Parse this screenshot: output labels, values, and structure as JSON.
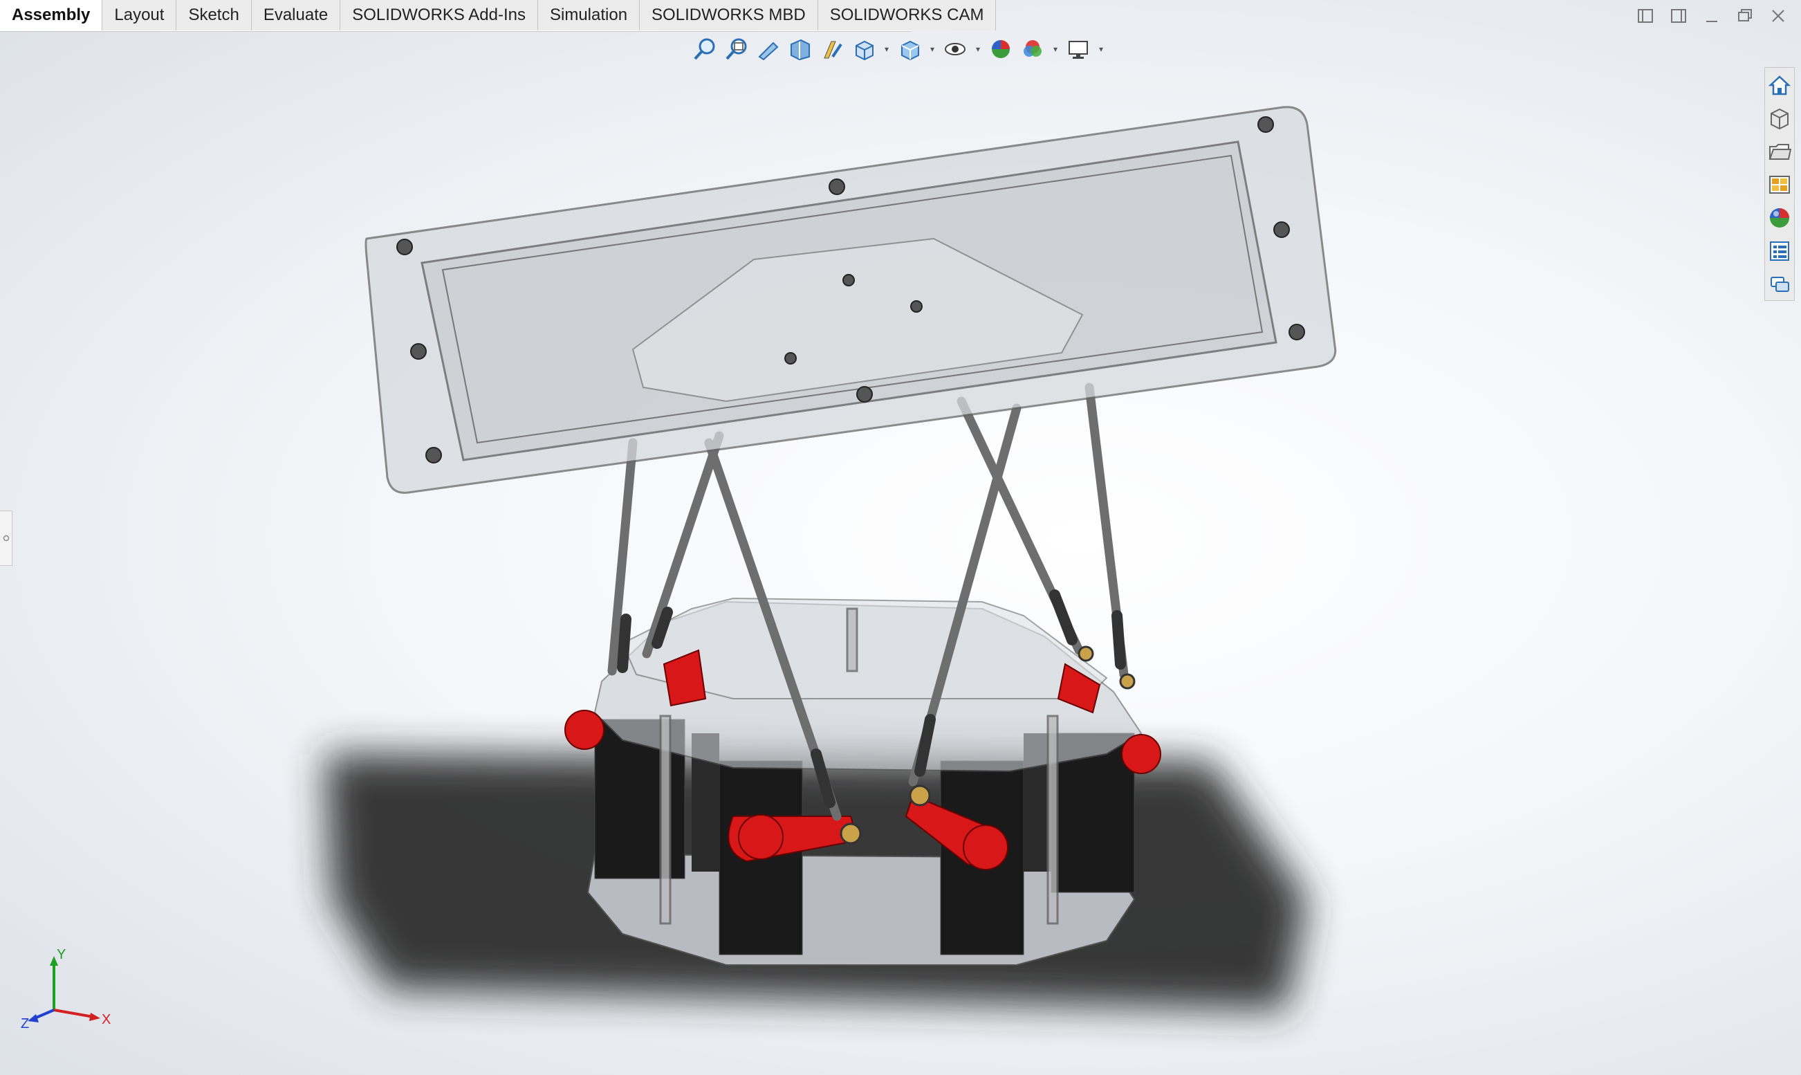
{
  "tabs": [
    {
      "label": "Assembly",
      "active": true
    },
    {
      "label": "Layout"
    },
    {
      "label": "Sketch"
    },
    {
      "label": "Evaluate"
    },
    {
      "label": "SOLIDWORKS Add-Ins"
    },
    {
      "label": "Simulation"
    },
    {
      "label": "SOLIDWORKS MBD"
    },
    {
      "label": "SOLIDWORKS CAM"
    }
  ],
  "triad": {
    "x": "X",
    "y": "Y",
    "z": "Z"
  },
  "colors": {
    "accent_red": "#d81818",
    "servo_black": "#1a1a1a",
    "rod_gray": "#6e6e6e",
    "acrylic": "#c8ccd2",
    "axis_x": "#d42020",
    "axis_y": "#20a020",
    "axis_z": "#2040d0"
  },
  "icons": {
    "heads_up": [
      "zoom-to-fit-icon",
      "zoom-to-area-icon",
      "previous-view-icon",
      "section-view-icon",
      "dynamic-annotation-icon",
      "view-orientation-icon",
      "display-style-icon",
      "hide-show-icon",
      "edit-appearance-icon",
      "apply-scene-icon",
      "view-settings-icon"
    ],
    "taskpane": [
      "home-icon",
      "design-library-icon",
      "file-explorer-icon",
      "view-palette-icon",
      "appearances-icon",
      "custom-properties-icon",
      "forum-icon"
    ]
  }
}
